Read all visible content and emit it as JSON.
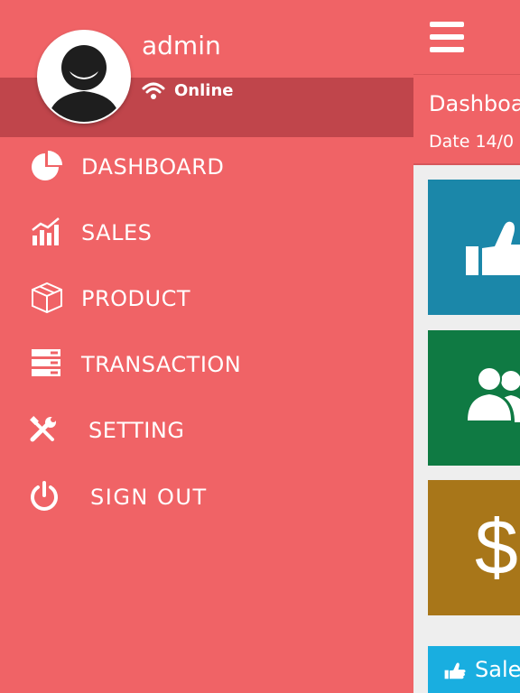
{
  "user": {
    "name": "admin",
    "status": "Online"
  },
  "nav": {
    "items": [
      {
        "label": "DASHBOARD",
        "icon": "pie-chart-icon"
      },
      {
        "label": "SALES",
        "icon": "bar-chart-icon"
      },
      {
        "label": "PRODUCT",
        "icon": "box-icon"
      },
      {
        "label": "TRANSACTION",
        "icon": "server-list-icon"
      },
      {
        "label": "SETTING",
        "icon": "tools-icon"
      },
      {
        "label": "SIGN OUT",
        "icon": "power-icon"
      }
    ]
  },
  "dashboard": {
    "title": "Dashboa",
    "date": "Date 14/0",
    "tiles": [
      {
        "icon": "thumbs-up-icon",
        "color": "#1b87a9"
      },
      {
        "icon": "users-icon",
        "color": "#0f7a43"
      },
      {
        "icon": "dollar-icon",
        "color": "#a87619",
        "symbol": "$"
      }
    ],
    "sales_button": {
      "label": "Sale",
      "icon": "thumbs-up-icon",
      "color": "#19aee0"
    }
  },
  "theme": {
    "accent": "#f06366",
    "band": "#c0454b",
    "background": "#eeeeee"
  }
}
